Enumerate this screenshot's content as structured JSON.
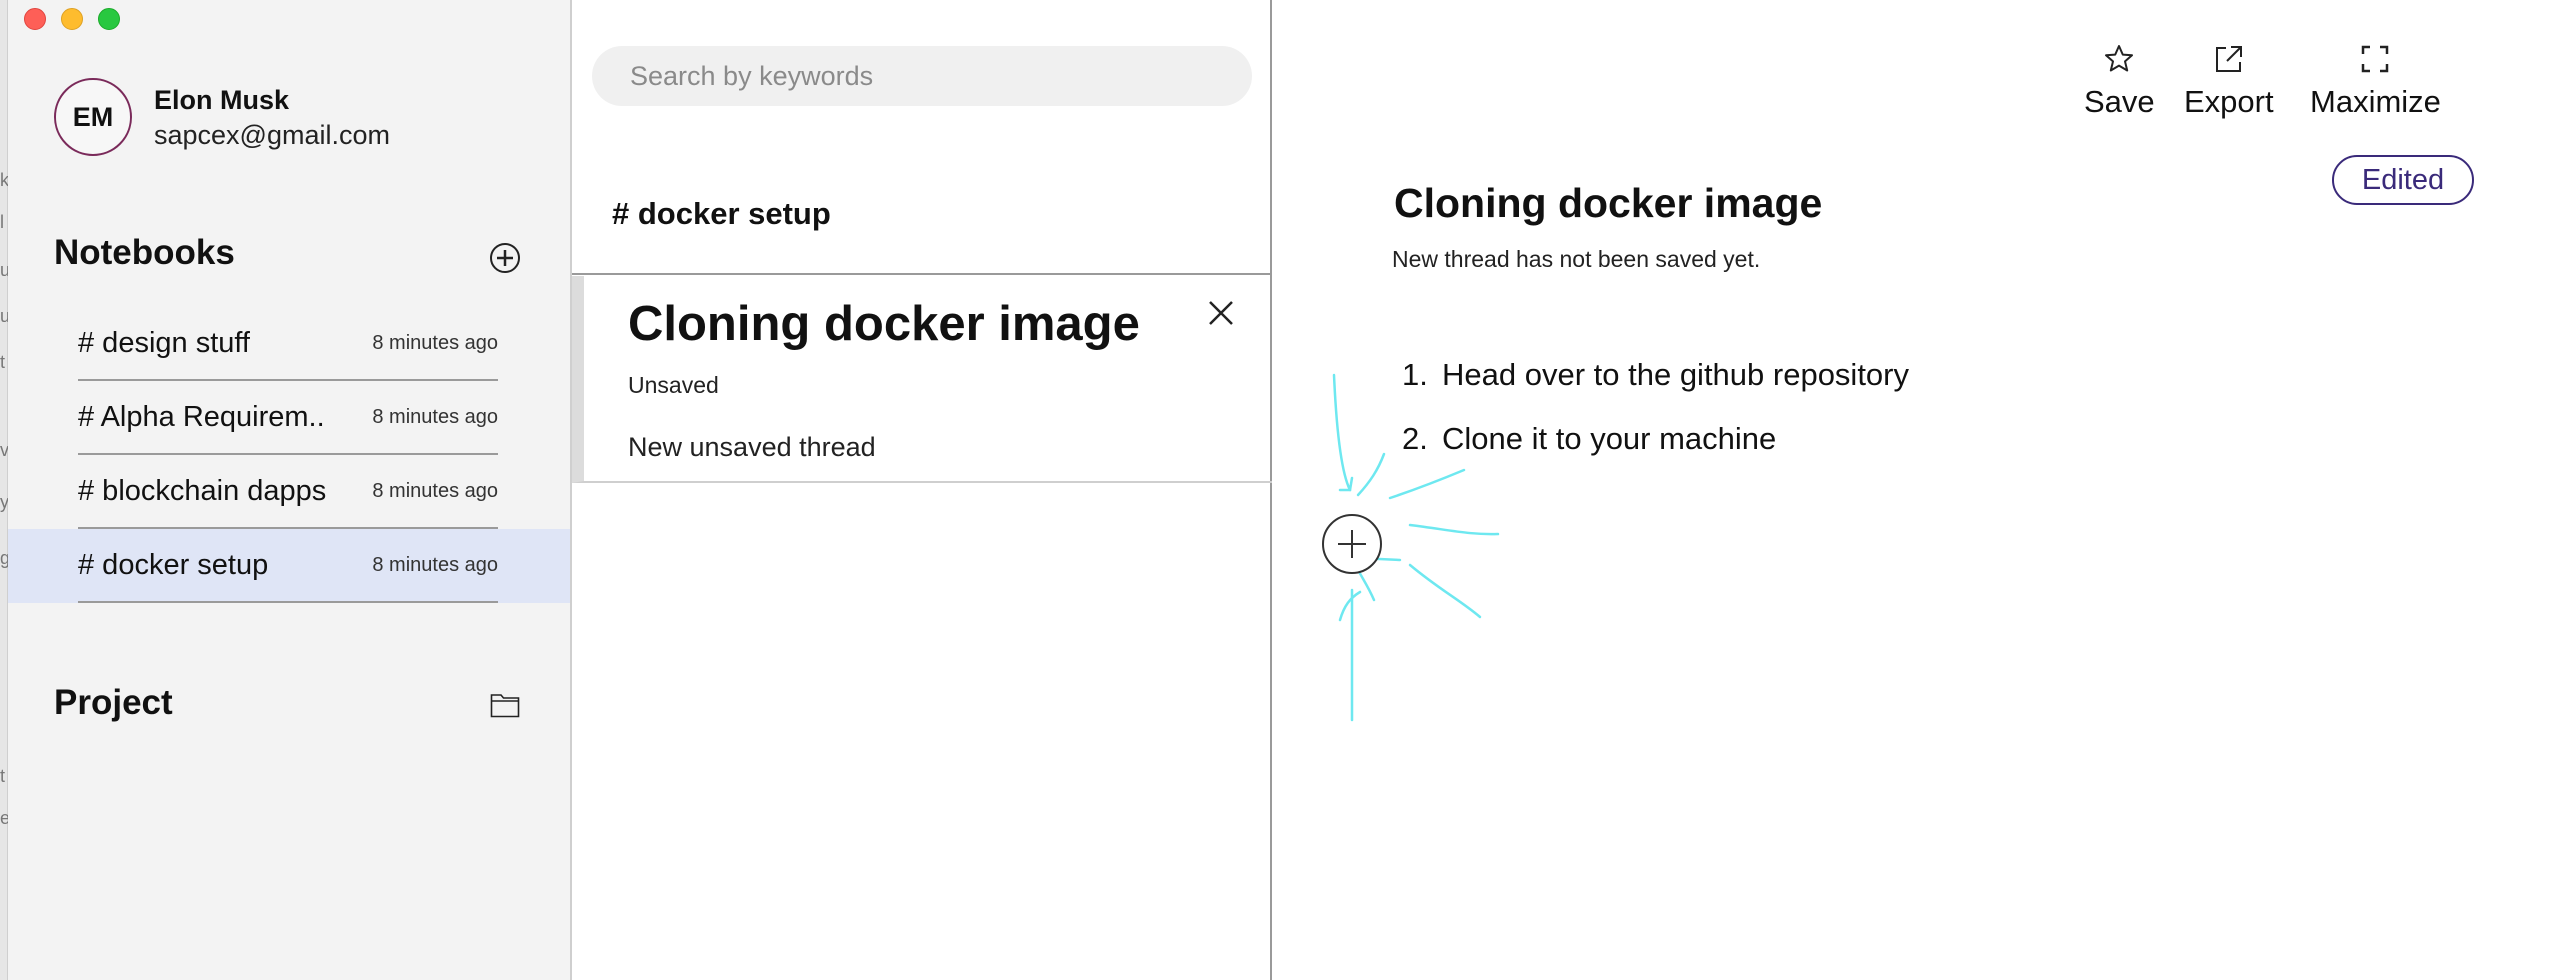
{
  "window": {
    "controls": [
      "close",
      "minimize",
      "zoom"
    ]
  },
  "edge_strip": {
    "letters": [
      "k",
      "l",
      "u",
      "u",
      "t",
      "v",
      "y",
      "g",
      "t",
      "e"
    ]
  },
  "user": {
    "initials": "EM",
    "name": "Elon Musk",
    "email": "sapcex@gmail.com"
  },
  "notebooks": {
    "title": "Notebooks",
    "add_icon": "plus-circle-icon",
    "items": [
      {
        "label": "# design stuff",
        "time": "8 minutes ago",
        "active": false
      },
      {
        "label": "# Alpha Requirem..",
        "time": "8 minutes ago",
        "active": false
      },
      {
        "label": "# blockchain dapps",
        "time": "8 minutes ago",
        "active": false
      },
      {
        "label": "# docker setup",
        "time": "8 minutes ago",
        "active": true
      }
    ]
  },
  "project": {
    "title": "Project",
    "icon": "folder-icon"
  },
  "search": {
    "placeholder": "Search by keywords",
    "value": ""
  },
  "list_pane": {
    "heading": "# docker setup",
    "thread": {
      "title": "Cloning docker image",
      "status": "Unsaved",
      "description": "New unsaved thread",
      "close_icon": "close-icon"
    }
  },
  "toolbar": {
    "save_label": "Save",
    "save_icon": "star-icon",
    "export_label": "Export",
    "export_icon": "external-link-icon",
    "maximize_label": "Maximize",
    "maximize_icon": "maximize-icon"
  },
  "editor": {
    "badge": "Edited",
    "title": "Cloning docker image",
    "subtitle": "New thread has not been saved yet.",
    "steps": [
      {
        "num": "1.",
        "text": "Head over to the github repository"
      },
      {
        "num": "2.",
        "text": "Clone it to your machine"
      }
    ],
    "insert_icon": "plus-circle-icon"
  },
  "colors": {
    "sidebar_bg": "#f3f3f3",
    "active_row": "#dfe5f6",
    "badge_accent": "#3a2a7a",
    "avatar_ring": "#7a2a5a",
    "highlight_strokes": "#6ee8f0"
  }
}
